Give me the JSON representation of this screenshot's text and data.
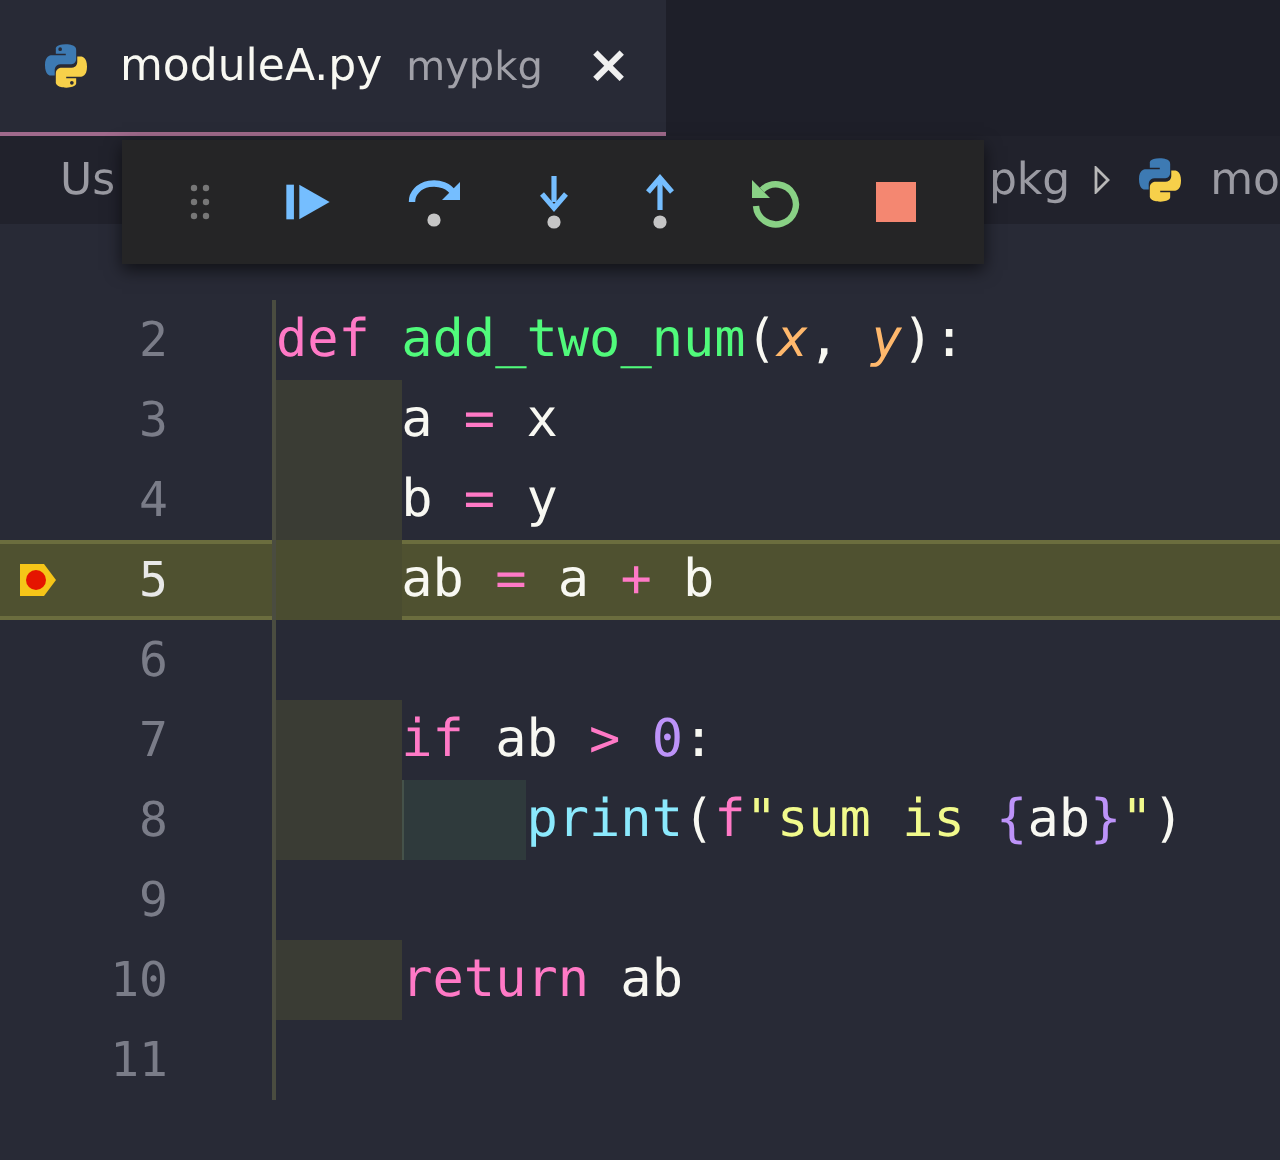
{
  "tab": {
    "title": "moduleA.py",
    "folder": "mypkg",
    "close": "×",
    "selected": true
  },
  "breadcrumb": {
    "start": "Us",
    "items": [
      "pkg",
      "mo"
    ]
  },
  "debug_toolbar": [
    {
      "kind": "grip"
    },
    {
      "kind": "continue"
    },
    {
      "kind": "step-over"
    },
    {
      "kind": "step-into"
    },
    {
      "kind": "step-out"
    },
    {
      "kind": "restart"
    },
    {
      "kind": "stop"
    }
  ],
  "lines": [
    {
      "number": "2",
      "current": false,
      "breakpoint": false,
      "tokens": [
        {
          "kind": "keyword",
          "text": "def"
        },
        {
          "kind": "function",
          "text": " add_two_num"
        },
        {
          "kind": "plain",
          "text": "("
        },
        {
          "kind": "param",
          "text": "x"
        },
        {
          "kind": "plain",
          "text": ", "
        },
        {
          "kind": "param",
          "text": "y"
        },
        {
          "kind": "plain",
          "text": "):"
        }
      ]
    },
    {
      "number": "3",
      "current": false,
      "breakpoint": false,
      "indents": [
        {
          "kind": "guide"
        }
      ],
      "tokens": [
        {
          "kind": "plain",
          "text": "a "
        },
        {
          "kind": "keyword",
          "text": "="
        },
        {
          "kind": "plain",
          "text": " x"
        }
      ]
    },
    {
      "number": "4",
      "current": false,
      "breakpoint": false,
      "indents": [
        {
          "kind": "guide"
        }
      ],
      "tokens": [
        {
          "kind": "plain",
          "text": "b "
        },
        {
          "kind": "keyword",
          "text": "="
        },
        {
          "kind": "plain",
          "text": " y"
        }
      ]
    },
    {
      "number": "5",
      "current": true,
      "breakpoint": true,
      "indents": [
        {
          "kind": "guide"
        }
      ],
      "tokens": [
        {
          "kind": "plain",
          "text": "ab "
        },
        {
          "kind": "keyword",
          "text": "="
        },
        {
          "kind": "plain",
          "text": " a "
        },
        {
          "kind": "keyword",
          "text": "+"
        },
        {
          "kind": "plain",
          "text": " b"
        }
      ]
    },
    {
      "number": "6",
      "current": false,
      "breakpoint": false
    },
    {
      "number": "7",
      "current": false,
      "breakpoint": false,
      "indents": [
        {
          "kind": "guide"
        }
      ],
      "tokens": [
        {
          "kind": "keyword",
          "text": "if"
        },
        {
          "kind": "plain",
          "text": " ab "
        },
        {
          "kind": "keyword",
          "text": ">"
        },
        {
          "kind": "number",
          "text": " 0"
        },
        {
          "kind": "plain",
          "text": ":"
        }
      ]
    },
    {
      "number": "8",
      "current": false,
      "breakpoint": false,
      "indents": [
        {
          "kind": "guide"
        },
        {
          "kind": "nested-guide"
        }
      ],
      "tokens": [
        {
          "kind": "builtin",
          "text": "print"
        },
        {
          "kind": "plain",
          "text": "("
        },
        {
          "kind": "keyword",
          "text": "f"
        },
        {
          "kind": "string",
          "text": "\"sum is "
        },
        {
          "kind": "number",
          "text": "{"
        },
        {
          "kind": "plain",
          "text": "ab"
        },
        {
          "kind": "number",
          "text": "}"
        },
        {
          "kind": "string",
          "text": "\""
        },
        {
          "kind": "plain",
          "text": ")"
        }
      ]
    },
    {
      "number": "9",
      "current": false,
      "breakpoint": false
    },
    {
      "number": "10",
      "current": false,
      "breakpoint": false,
      "indents": [
        {
          "kind": "guide"
        }
      ],
      "tokens": [
        {
          "kind": "keyword",
          "text": "return"
        },
        {
          "kind": "plain",
          "text": " ab"
        }
      ]
    },
    {
      "number": "11",
      "current": false,
      "breakpoint": false
    }
  ]
}
